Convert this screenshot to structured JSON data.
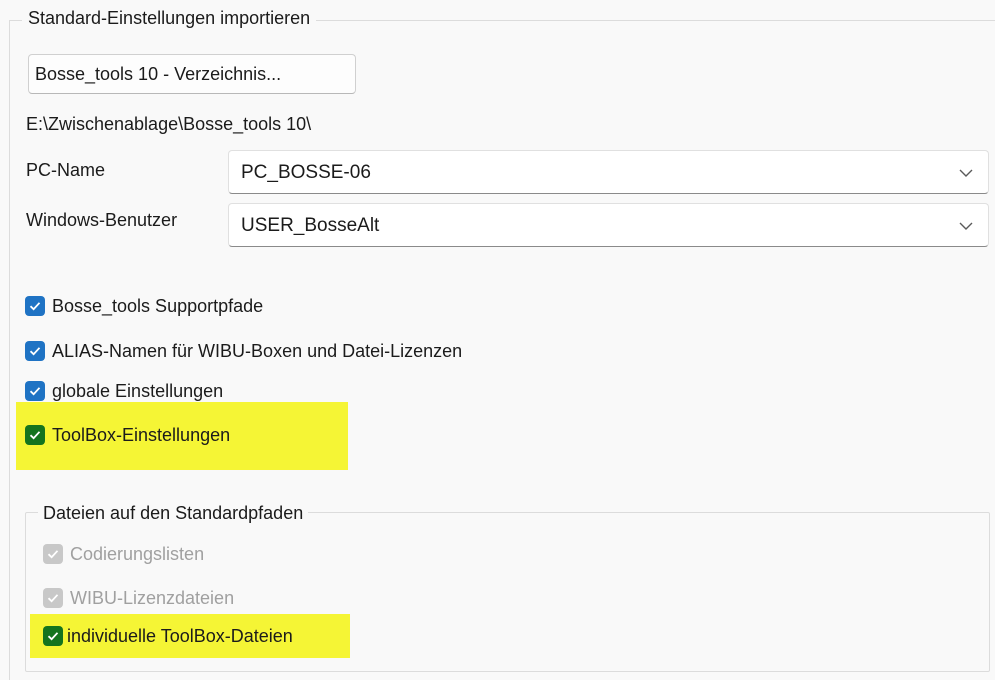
{
  "import_group": {
    "title": "Standard-Einstellungen importieren",
    "directory_button": "Bosse_tools 10 - Verzeichnis...",
    "path": "E:\\Zwischenablage\\Bosse_tools 10\\",
    "pc_name": {
      "label": "PC-Name",
      "value": "PC_BOSSE-06"
    },
    "windows_user": {
      "label": "Windows-Benutzer",
      "value": "USER_BosseAlt"
    },
    "options": [
      {
        "label": "Bosse_tools Supportpfade",
        "checked": true
      },
      {
        "label": "ALIAS-Namen für WIBU-Boxen und Datei-Lizenzen",
        "checked": true
      },
      {
        "label": "globale Einstellungen",
        "checked": true
      },
      {
        "label": "ToolBox-Einstellungen",
        "checked": true,
        "highlighted": true
      }
    ]
  },
  "files_group": {
    "title": "Dateien auf den Standardpfaden",
    "options": [
      {
        "label": "Codierungslisten",
        "checked": true,
        "disabled": true
      },
      {
        "label": "WIBU-Lizenzdateien",
        "checked": true,
        "disabled": true
      },
      {
        "label": "individuelle ToolBox-Dateien",
        "checked": true,
        "highlighted": true
      }
    ]
  },
  "colors": {
    "checkbox_blue": "#1f73c4",
    "checkbox_green": "#14741e",
    "highlight_yellow": "#f5f535",
    "checkbox_disabled": "#c8c8c8"
  },
  "icons": {
    "dropdown": "chevron-down-icon",
    "check": "checkmark-icon"
  }
}
